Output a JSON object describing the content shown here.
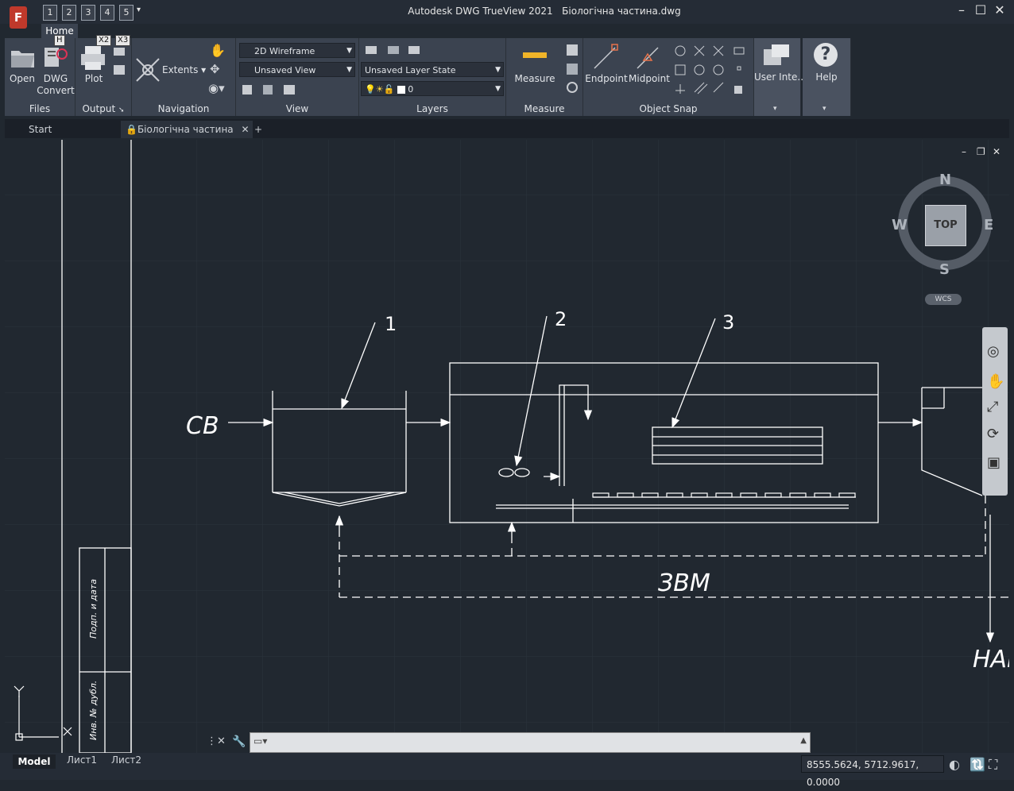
{
  "app": {
    "title": "Autodesk DWG TrueView 2021",
    "document": "Біологічна частина.dwg",
    "logo_letter": "F"
  },
  "qat": {
    "buttons": [
      "1",
      "2",
      "3",
      "4",
      "5"
    ],
    "keytips": [
      "H",
      "X2",
      "X3"
    ]
  },
  "ribbon": {
    "active_tab": "Home",
    "files": {
      "label": "Files",
      "open": "Open",
      "dwg": "DWG",
      "convert": "Convert"
    },
    "output": {
      "label": "Output",
      "plot": "Plot"
    },
    "navigation": {
      "label": "Navigation",
      "extents": "Extents"
    },
    "view": {
      "label": "View",
      "visual_style": "2D Wireframe",
      "named_view": "Unsaved View"
    },
    "layers": {
      "label": "Layers",
      "layer_state": "Unsaved Layer State",
      "current_layer": "0"
    },
    "measure": {
      "label": "Measure",
      "measure": "Measure"
    },
    "osnap": {
      "label": "Object Snap",
      "endpoint": "Endpoint",
      "midpoint": "Midpoint"
    },
    "ui": {
      "label": "User Inte..."
    },
    "help": {
      "label": "Help"
    }
  },
  "doc_tabs": {
    "start": "Start",
    "active": "Біологічна частина",
    "add": "+"
  },
  "viewcube": {
    "n": "N",
    "s": "S",
    "e": "E",
    "w": "W",
    "face": "TOP",
    "ucs": "WCS"
  },
  "drawing": {
    "callouts": [
      "1",
      "2",
      "3"
    ],
    "inlet": "СВ",
    "return_line": "ЗВМ",
    "outlet": "НАІ",
    "stamp1": "Подп. и дата",
    "stamp2": "Инв. № дубл."
  },
  "status": {
    "layouts": [
      "Model",
      "Лист1",
      "Лист2"
    ],
    "coords": "8555.5624, 5712.9617, 0.0000"
  }
}
